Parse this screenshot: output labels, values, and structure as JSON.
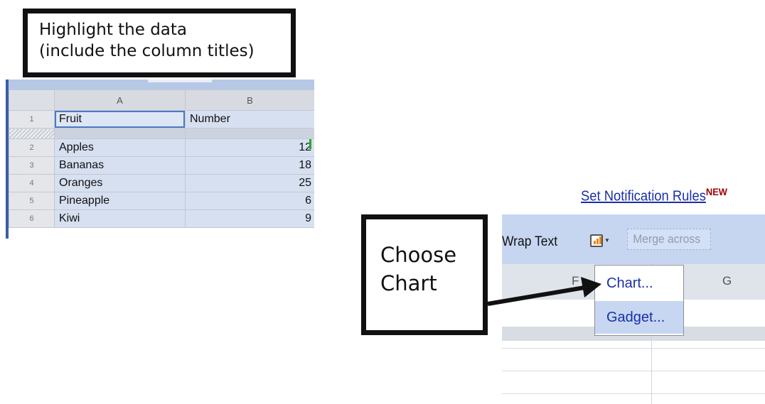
{
  "callout_highlight": {
    "lines": [
      "Highlight the data",
      "(include the column titles)"
    ]
  },
  "callout_chart": {
    "lines": [
      "Choose",
      "Chart"
    ]
  },
  "spreadsheet_left": {
    "column_headers": [
      "A",
      "B"
    ],
    "header_row": {
      "row_number": "1",
      "cells": [
        "Fruit",
        "Number"
      ]
    },
    "rows": [
      {
        "row_number": "2",
        "fruit": "Apples",
        "number": "12"
      },
      {
        "row_number": "3",
        "fruit": "Bananas",
        "number": "18"
      },
      {
        "row_number": "4",
        "fruit": "Oranges",
        "number": "25"
      },
      {
        "row_number": "5",
        "fruit": "Pineapple",
        "number": "6"
      },
      {
        "row_number": "6",
        "fruit": "Kiwi",
        "number": "9"
      }
    ]
  },
  "notification": {
    "link_label": "Set Notification Rules",
    "badge": "NEW"
  },
  "toolbar": {
    "wrap_text_label": "Wrap Text",
    "chart_icon": "chart-icon",
    "merge_label": "Merge across"
  },
  "spreadsheet_right": {
    "column_headers": [
      "F",
      "G"
    ]
  },
  "chart_menu": {
    "items": [
      "Chart...",
      "Gadget..."
    ]
  },
  "colors": {
    "toolbar_bg": "#c6d6f1",
    "link": "#1a2fa8",
    "new_badge": "#a00000",
    "selection_fill": "#d6e0f1",
    "menu_highlight": "#c7d7f1"
  }
}
